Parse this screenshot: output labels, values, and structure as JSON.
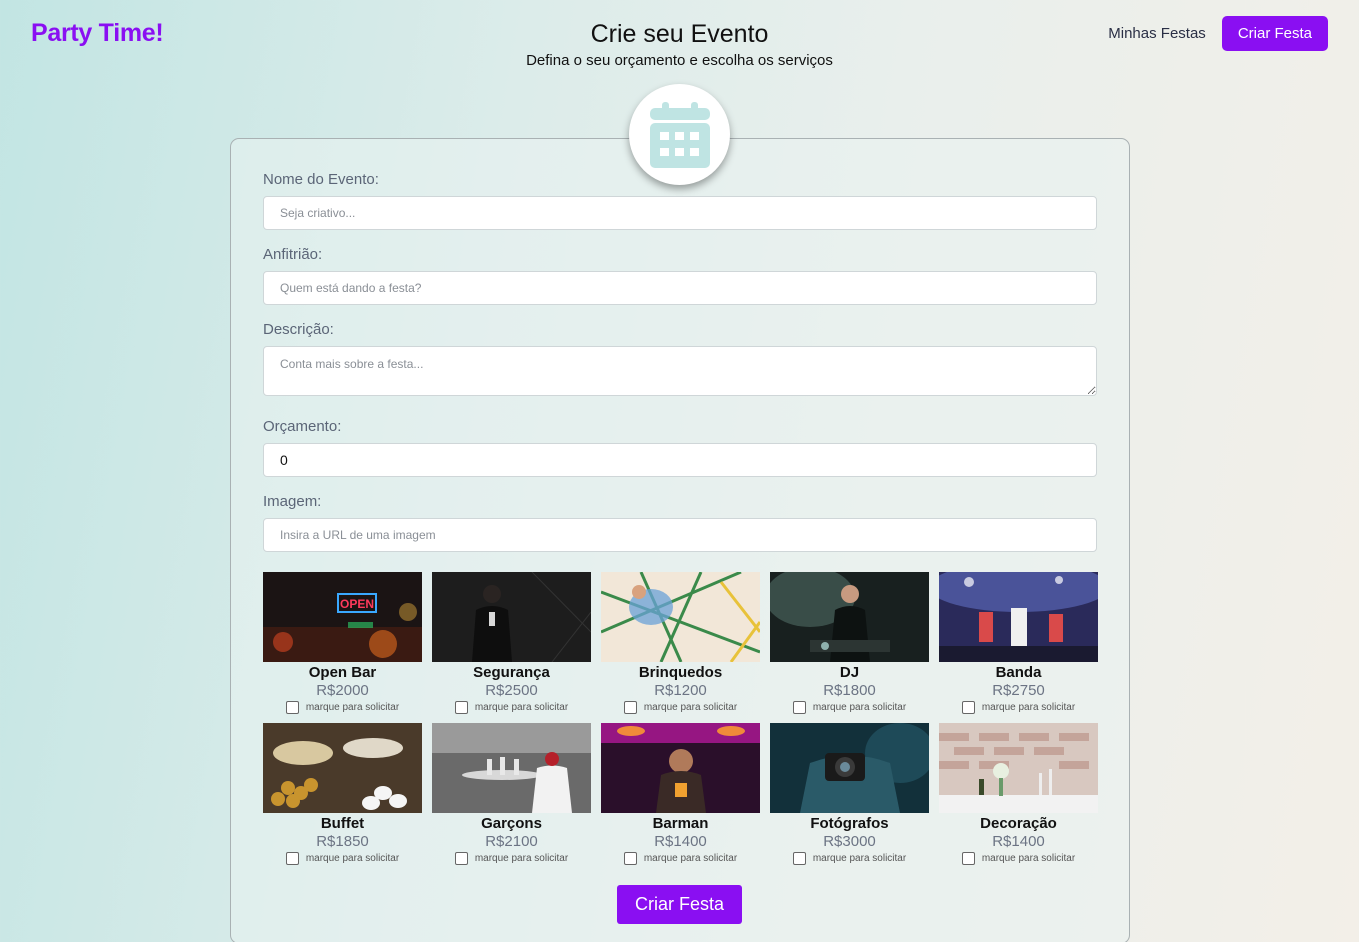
{
  "brand": "Party Time!",
  "header": {
    "title": "Crie seu Evento",
    "subtitle": "Defina o seu orçamento e escolha os serviços"
  },
  "nav": {
    "my_parties": "Minhas Festas",
    "create_party": "Criar Festa"
  },
  "badge_icon": "calendar-icon",
  "form": {
    "name": {
      "label": "Nome do Evento:",
      "placeholder": "Seja criativo..."
    },
    "host": {
      "label": "Anfitrião:",
      "placeholder": "Quem está dando a festa?"
    },
    "description": {
      "label": "Descrição:",
      "placeholder": "Conta mais sobre a festa..."
    },
    "budget": {
      "label": "Orçamento:",
      "value": "0"
    },
    "image": {
      "label": "Imagem:",
      "placeholder": "Insira a URL de uma imagem"
    }
  },
  "services": [
    {
      "name": "Open Bar",
      "price": "R$2000",
      "hint": "marque para solicitar"
    },
    {
      "name": "Segurança",
      "price": "R$2500",
      "hint": "marque para solicitar"
    },
    {
      "name": "Brinquedos",
      "price": "R$1200",
      "hint": "marque para solicitar"
    },
    {
      "name": "DJ",
      "price": "R$1800",
      "hint": "marque para solicitar"
    },
    {
      "name": "Banda",
      "price": "R$2750",
      "hint": "marque para solicitar"
    },
    {
      "name": "Buffet",
      "price": "R$1850",
      "hint": "marque para solicitar"
    },
    {
      "name": "Garçons",
      "price": "R$2100",
      "hint": "marque para solicitar"
    },
    {
      "name": "Barman",
      "price": "R$1400",
      "hint": "marque para solicitar"
    },
    {
      "name": "Fotógrafos",
      "price": "R$3000",
      "hint": "marque para solicitar"
    },
    {
      "name": "Decoração",
      "price": "R$1400",
      "hint": "marque para solicitar"
    }
  ],
  "submit_label": "Criar Festa",
  "colors": {
    "accent": "#8a0ff2",
    "badge_icon": "#bfe4e3"
  }
}
